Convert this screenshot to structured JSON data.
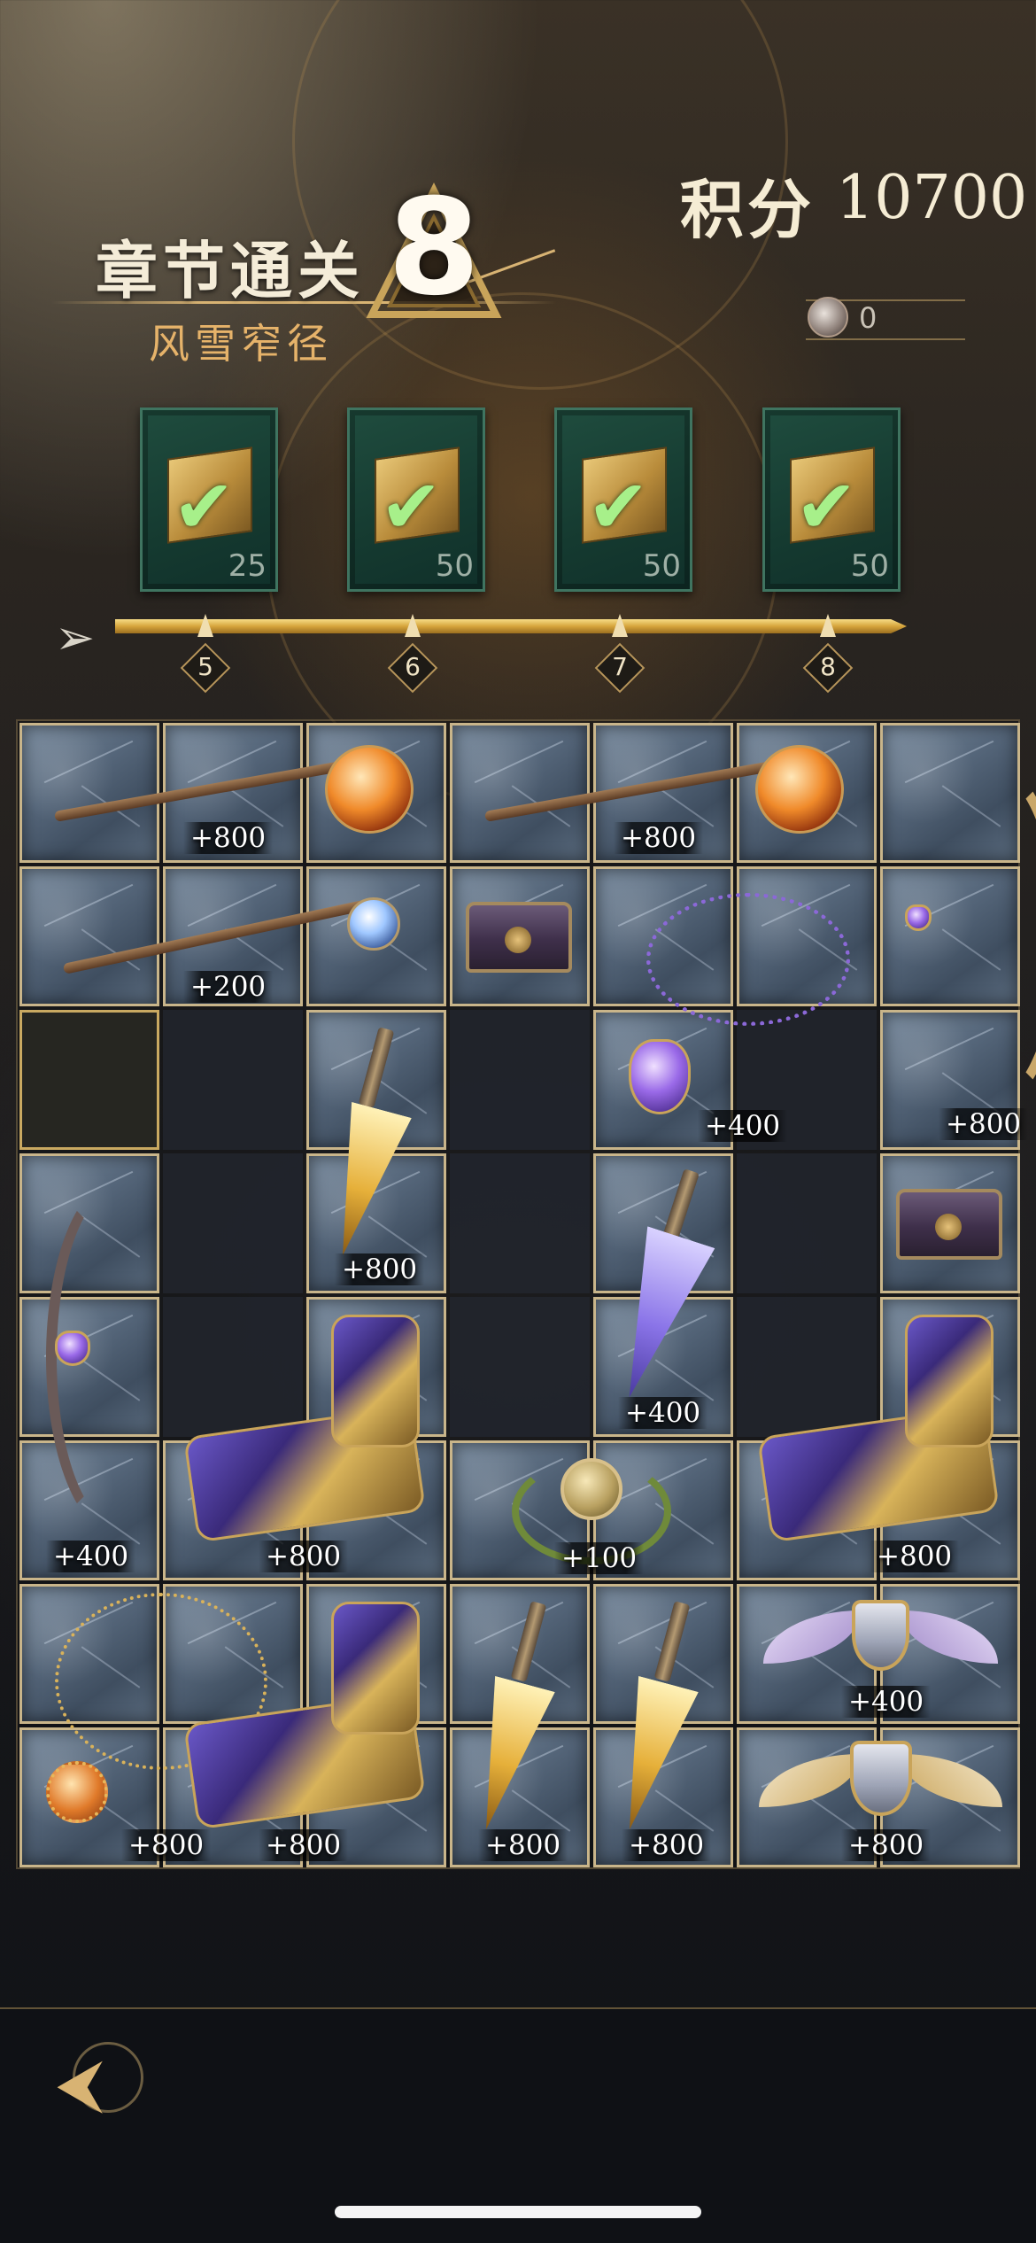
{
  "header": {
    "chapter_title": "章节通关",
    "chapter_subtitle": "风雪窄径",
    "chapter_number": "8",
    "score_label": "积分",
    "score_value": "10700",
    "token_count": "0",
    "token_icon": "emblem-token-icon"
  },
  "rewards": [
    {
      "icon": "gold-cube-icon",
      "count": "25",
      "claimed": true
    },
    {
      "icon": "gold-cube-icon",
      "count": "50",
      "claimed": true
    },
    {
      "icon": "gold-cube-icon",
      "count": "50",
      "claimed": true
    },
    {
      "icon": "gold-cube-icon",
      "count": "50",
      "claimed": true
    }
  ],
  "progress": {
    "milestones": [
      "5",
      "6",
      "7",
      "8"
    ],
    "fill_fraction": 1.0
  },
  "grid": {
    "columns": 7,
    "rows": 8,
    "cells": [
      "F",
      "F",
      "F",
      "F",
      "F",
      "F",
      "F",
      "F",
      "F",
      "F",
      "F",
      "F",
      "F",
      "F",
      "S",
      "E",
      "F",
      "E",
      "F",
      "E",
      "F",
      "F",
      "E",
      "F",
      "E",
      "F",
      "E",
      "F",
      "F",
      "E",
      "F",
      "E",
      "F",
      "E",
      "F",
      "F",
      "F",
      "F",
      "F",
      "F",
      "F",
      "F",
      "F",
      "F",
      "F",
      "F",
      "F",
      "F",
      "F",
      "F",
      "F",
      "F",
      "F",
      "F",
      "F",
      "F"
    ],
    "items": [
      {
        "name": "fire-orb-staff",
        "type": "staff",
        "label": "+800"
      },
      {
        "name": "fire-orb-staff",
        "type": "staff",
        "label": "+800"
      },
      {
        "name": "golden-bow",
        "type": "bow",
        "label": "+800"
      },
      {
        "name": "blue-gem-wand",
        "type": "wand",
        "label": "+200"
      },
      {
        "name": "treasure-chest",
        "type": "chest",
        "label": ""
      },
      {
        "name": "amethyst-necklace",
        "type": "necklace",
        "label": "+400"
      },
      {
        "name": "golden-dagger",
        "type": "dagger",
        "label": "+800"
      },
      {
        "name": "crystal-dagger",
        "type": "dagger",
        "label": "+400"
      },
      {
        "name": "treasure-chest",
        "type": "chest",
        "label": ""
      },
      {
        "name": "dark-winged-bow",
        "type": "bow",
        "label": "+400"
      },
      {
        "name": "purple-gauntlet",
        "type": "gauntlet",
        "label": "+800"
      },
      {
        "name": "laurel-medallion",
        "type": "medal",
        "label": "+100"
      },
      {
        "name": "purple-gauntlet",
        "type": "gauntlet",
        "label": "+800"
      },
      {
        "name": "winged-purple-shield",
        "type": "shield",
        "label": "+400"
      },
      {
        "name": "sun-pendant-necklace",
        "type": "necklace",
        "label": "+800"
      },
      {
        "name": "purple-gauntlet",
        "type": "gauntlet",
        "label": "+800"
      },
      {
        "name": "golden-dagger",
        "type": "dagger",
        "label": "+800"
      },
      {
        "name": "golden-dagger",
        "type": "dagger",
        "label": "+800"
      },
      {
        "name": "winged-gold-shield",
        "type": "shield",
        "label": "+800"
      }
    ]
  },
  "footer": {
    "back_icon": "back-arrow-icon"
  },
  "colors": {
    "gold_accent": "#d8b373",
    "card_green": "#1f4c3e",
    "check_green": "#a7f08a",
    "subtitle_orange": "#e6b36a"
  }
}
